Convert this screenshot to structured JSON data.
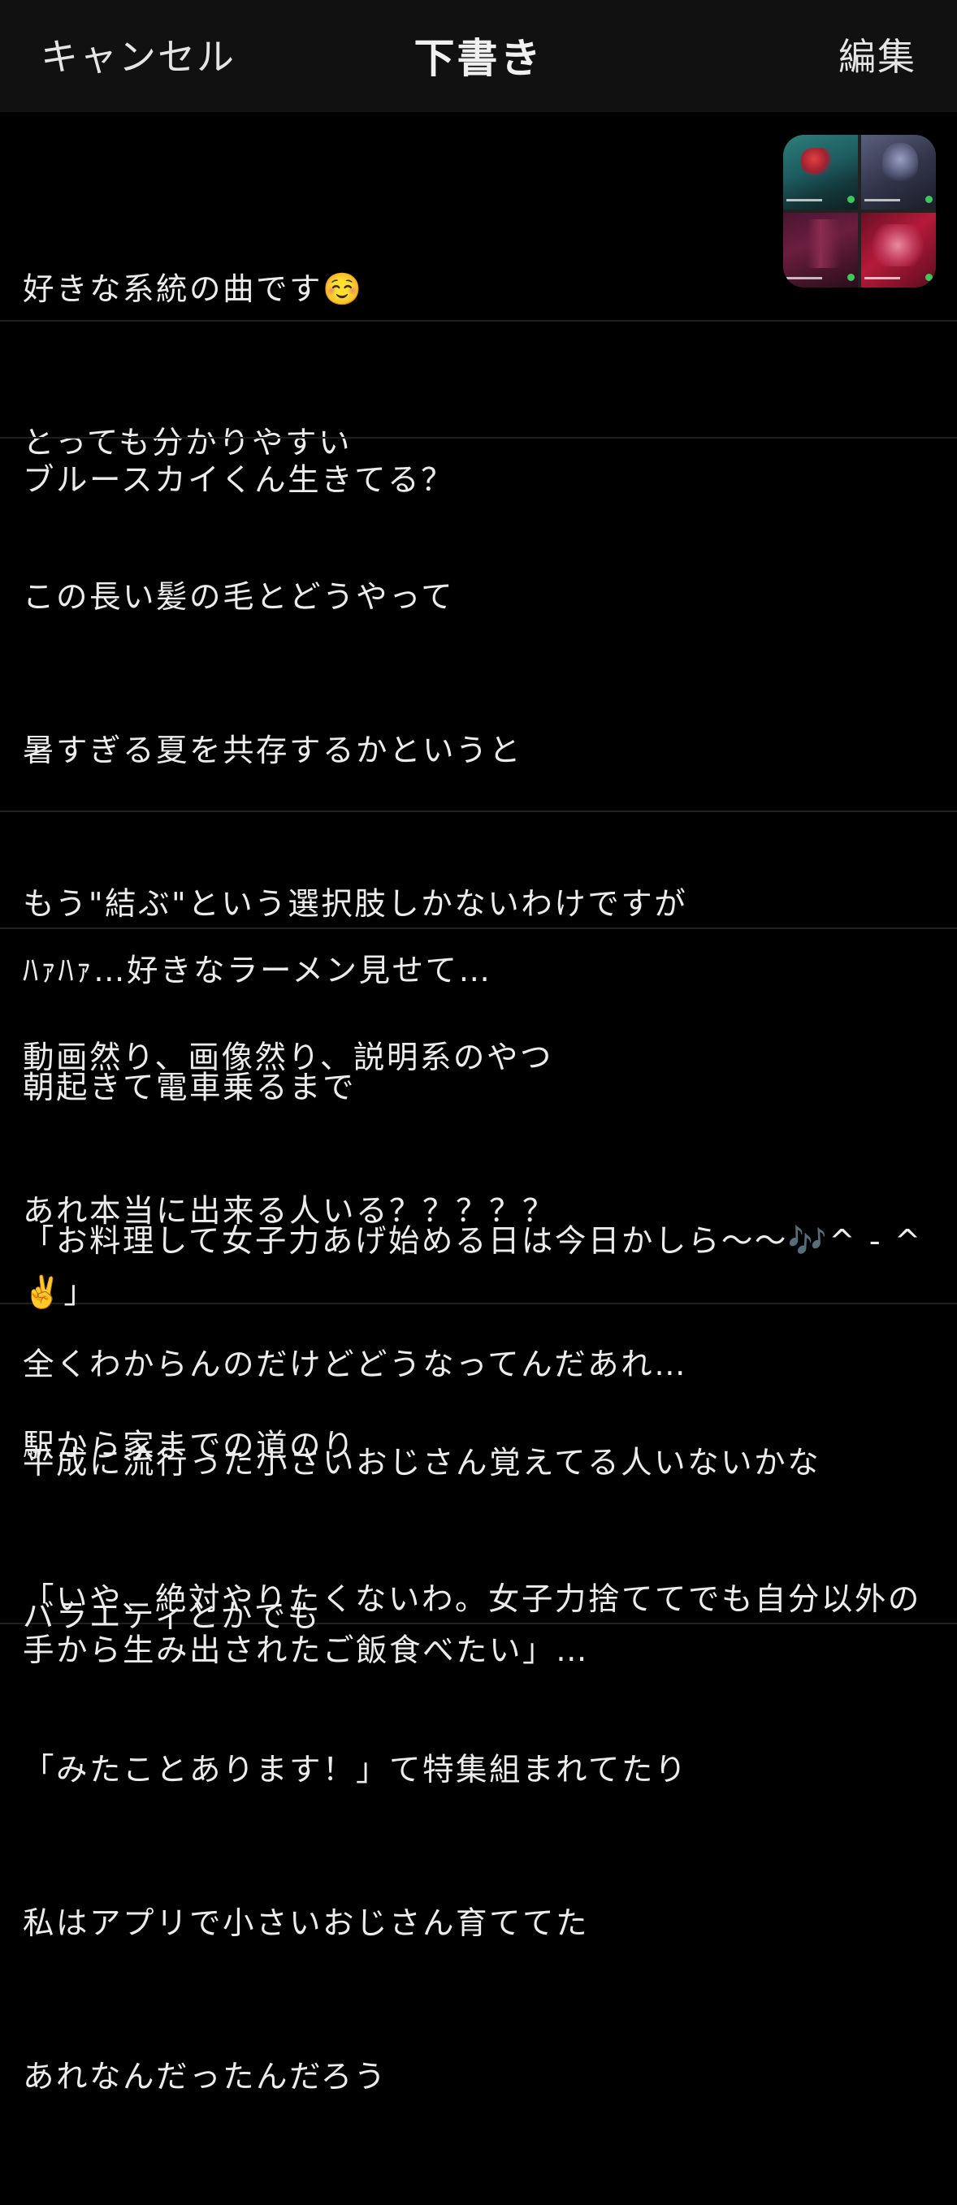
{
  "header": {
    "cancel_label": "キャンセル",
    "title": "下書き",
    "edit_label": "編集"
  },
  "drafts": [
    {
      "lines": [
        "好きな系統の曲です☺️",
        "とっても分かりやすい"
      ],
      "has_thumbnails": true,
      "thumbnail_icons": [
        "album-art-teal",
        "album-art-gray",
        "album-art-crimson-dark",
        "album-art-crimson-bright"
      ]
    },
    {
      "lines": [
        "ブルースカイくん生きてる？"
      ]
    },
    {
      "lines": [
        "この長い髪の毛とどうやって",
        "暑すぎる夏を共存するかというと",
        "もう\"結ぶ\"という選択肢しかないわけですが",
        "動画然り、画像然り、説明系のやつ",
        "あれ本当に出来る人いる？？？？？",
        "全くわからんのだけどどうなってんだあれ…"
      ]
    },
    {
      "lines": [
        "ﾊｧﾊｧ…好きなラーメン見せて…"
      ]
    },
    {
      "lines": [
        "朝起きて電車乗るまで",
        "「お料理して女子力あげ始める日は今日かしら〜〜🎶^ - ^✌️」",
        "駅から家までの道のり",
        "「いや、絶対やりたくないわ。女子力捨ててでも自分以外の手から生み出されたご飯食べたい」…"
      ]
    },
    {
      "lines": [
        "平成に流行った小さいおじさん覚えてる人いないかな",
        "バラエティとかでも",
        "「みたことあります！」て特集組まれてたり",
        "私はアプリで小さいおじさん育ててた",
        "あれなんだったんだろう"
      ]
    }
  ]
}
